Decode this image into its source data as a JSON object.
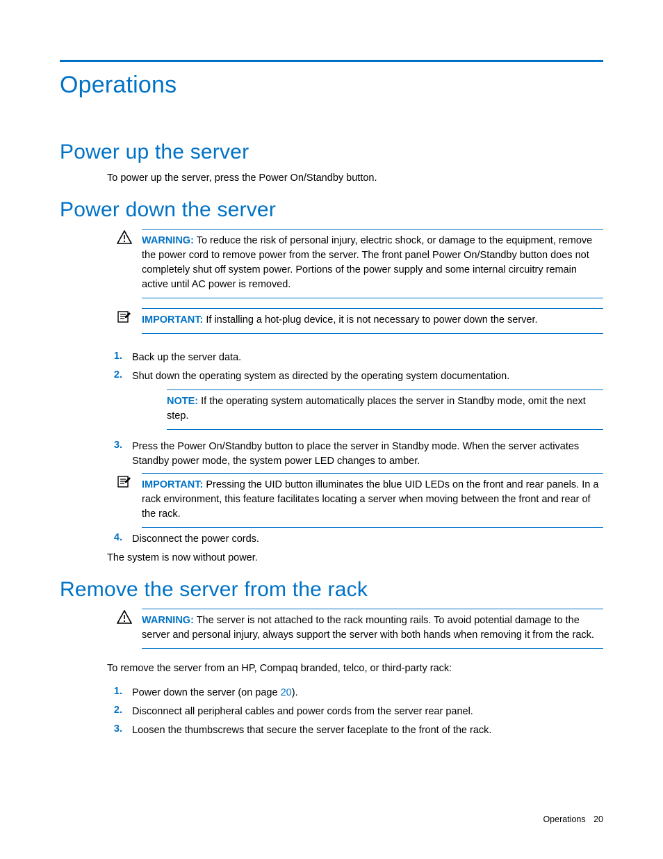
{
  "title": "Operations",
  "sections": {
    "power_up": {
      "heading": "Power up the server",
      "body": "To power up the server, press the Power On/Standby button."
    },
    "power_down": {
      "heading": "Power down the server",
      "warning_label": "WARNING:",
      "warning_text": "To reduce the risk of personal injury, electric shock, or damage to the equipment, remove the power cord to remove power from the server. The front panel Power On/Standby button does not completely shut off system power. Portions of the power supply and some internal circuitry remain active until AC power is removed.",
      "important_label": "IMPORTANT:",
      "important_text": "If installing a hot-plug device, it is not necessary to power down the server.",
      "steps": [
        {
          "n": "1.",
          "text": "Back up the server data."
        },
        {
          "n": "2.",
          "text": "Shut down the operating system as directed by the operating system documentation."
        },
        {
          "n": "3.",
          "text": "Press the Power On/Standby button to place the server in Standby mode. When the server activates Standby power mode, the system power LED changes to amber."
        },
        {
          "n": "4.",
          "text": "Disconnect the power cords."
        }
      ],
      "note_label": "NOTE:",
      "note_text": "If the operating system automatically places the server in Standby mode, omit the next step.",
      "important2_label": "IMPORTANT:",
      "important2_text": "Pressing the UID button illuminates the blue UID LEDs on the front and rear panels. In a rack environment, this feature facilitates locating a server when moving between the front and rear of the rack.",
      "closing": "The system is now without power."
    },
    "remove_rack": {
      "heading": "Remove the server from the rack",
      "warning_label": "WARNING:",
      "warning_text": "The server is not attached to the rack mounting rails. To avoid potential damage to the server and personal injury, always support the server with both hands when removing it from the rack.",
      "intro": "To remove the server from an HP, Compaq branded, telco, or third-party rack:",
      "steps": [
        {
          "n": "1.",
          "prefix": "Power down the server (on page ",
          "link": "20",
          "suffix": ")."
        },
        {
          "n": "2.",
          "text": "Disconnect all peripheral cables and power cords from the server rear panel."
        },
        {
          "n": "3.",
          "text": "Loosen the thumbscrews that secure the server faceplate to the front of the rack."
        }
      ]
    }
  },
  "footer": {
    "label": "Operations",
    "page": "20"
  }
}
